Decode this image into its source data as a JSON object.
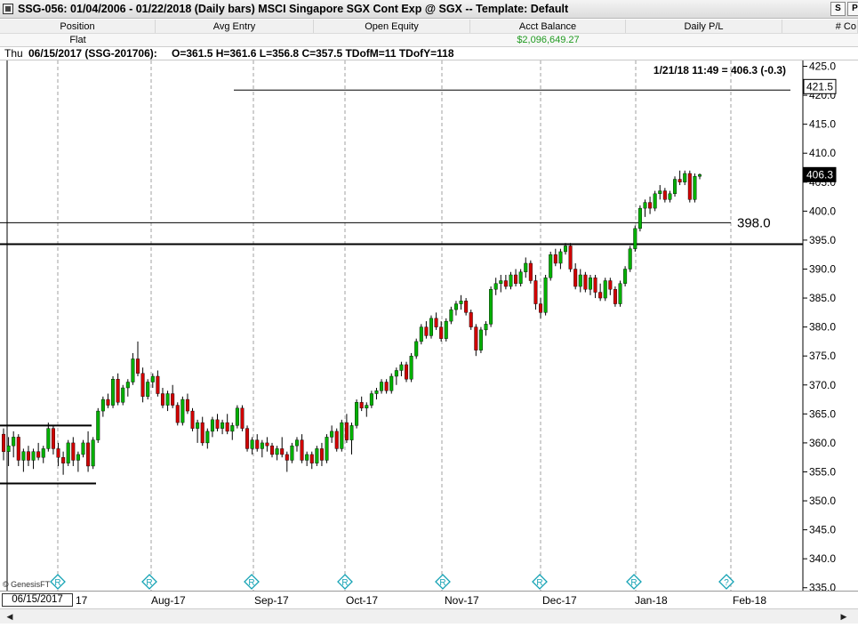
{
  "window": {
    "title": "SSG-056:  01/04/2006 - 01/22/2018  (Daily bars)   MSCI Singapore SGX Cont Exp @ SGX  --  Template: Default",
    "btn_s": "S",
    "btn_p": "P"
  },
  "account": {
    "headers": [
      "Position",
      "Avg Entry",
      "Open Equity",
      "Acct Balance",
      "Daily P/L",
      "# Co"
    ],
    "position_value": "Flat",
    "balance_value": "$2,096,649.27"
  },
  "info": {
    "day": "Thu",
    "date_symbol": "06/15/2017 (SSG-201706):",
    "ohlc": "O=361.5  H=361.6  L=356.8  C=357.5  TDofM=11  TDofY=118"
  },
  "chart_data": {
    "type": "candlestick",
    "title": "",
    "last_quote": "1/21/18 11:49 = 406.3 (-0.3)",
    "y_ticks": [
      335.0,
      340.0,
      345.0,
      350.0,
      355.0,
      360.0,
      365.0,
      370.0,
      375.0,
      380.0,
      385.0,
      390.0,
      395.0,
      400.0,
      405.0,
      410.0,
      415.0,
      420.0,
      425.0
    ],
    "ylim": [
      334.5,
      426.0
    ],
    "price_flag": "406.3",
    "price_flag_value": 406.3,
    "alert_flag": "421.5",
    "alert_flag_value": 421.5,
    "hline_label": "398.0",
    "hline_value": 398.0,
    "support_line_value": 394.3,
    "upper_line_value": 420.9,
    "x_labels": [
      "17",
      "Aug-17",
      "Sep-17",
      "Oct-17",
      "Nov-17",
      "Dec-17",
      "Jan-18",
      "Feb-18"
    ],
    "watermark": "© GenesisFT",
    "bars": [
      [
        361.5,
        362.5,
        357.0,
        358.5
      ],
      [
        358.5,
        361.0,
        356.0,
        359.5
      ],
      [
        359.5,
        362.0,
        357.5,
        361.0
      ],
      [
        361.0,
        361.5,
        356.0,
        357.0
      ],
      [
        357.0,
        359.0,
        355.0,
        358.5
      ],
      [
        358.5,
        359.5,
        356.0,
        357.0
      ],
      [
        357.0,
        359.0,
        355.5,
        358.5
      ],
      [
        358.5,
        360.0,
        357.0,
        357.5
      ],
      [
        357.5,
        359.5,
        356.5,
        359.0
      ],
      [
        359.0,
        363.5,
        358.5,
        362.5
      ],
      [
        362.5,
        363.0,
        358.0,
        359.0
      ],
      [
        359.0,
        360.0,
        356.0,
        357.5
      ],
      [
        357.5,
        358.5,
        354.5,
        356.5
      ],
      [
        356.5,
        360.5,
        356.0,
        360.0
      ],
      [
        360.0,
        361.0,
        356.0,
        357.0
      ],
      [
        357.0,
        358.5,
        355.0,
        358.0
      ],
      [
        358.0,
        360.5,
        357.5,
        360.0
      ],
      [
        360.0,
        362.0,
        355.0,
        356.0
      ],
      [
        356.0,
        361.0,
        355.5,
        360.5
      ],
      [
        360.5,
        366.0,
        360.0,
        365.5
      ],
      [
        365.5,
        368.0,
        364.5,
        367.5
      ],
      [
        367.5,
        368.5,
        366.0,
        366.5
      ],
      [
        366.5,
        371.5,
        366.0,
        371.0
      ],
      [
        371.0,
        372.0,
        366.5,
        367.0
      ],
      [
        367.0,
        370.0,
        366.5,
        369.5
      ],
      [
        369.5,
        371.0,
        368.0,
        370.5
      ],
      [
        370.5,
        375.5,
        370.0,
        374.5
      ],
      [
        374.5,
        377.5,
        371.5,
        372.0
      ],
      [
        372.0,
        373.0,
        367.0,
        368.0
      ],
      [
        368.0,
        371.0,
        367.5,
        370.5
      ],
      [
        370.5,
        372.0,
        369.5,
        371.5
      ],
      [
        371.5,
        372.5,
        368.0,
        368.5
      ],
      [
        368.5,
        369.5,
        366.0,
        366.5
      ],
      [
        366.5,
        369.0,
        365.5,
        368.5
      ],
      [
        368.5,
        370.0,
        366.0,
        366.5
      ],
      [
        366.5,
        367.0,
        363.0,
        363.5
      ],
      [
        363.5,
        368.0,
        363.0,
        367.5
      ],
      [
        367.5,
        368.5,
        365.0,
        365.5
      ],
      [
        365.5,
        366.0,
        362.0,
        362.5
      ],
      [
        362.5,
        364.0,
        360.0,
        363.5
      ],
      [
        363.5,
        364.5,
        359.5,
        360.0
      ],
      [
        360.0,
        362.5,
        359.0,
        362.0
      ],
      [
        362.0,
        364.5,
        361.0,
        364.0
      ],
      [
        364.0,
        365.0,
        362.0,
        362.5
      ],
      [
        362.5,
        364.0,
        361.5,
        363.5
      ],
      [
        363.5,
        365.0,
        361.5,
        362.0
      ],
      [
        362.0,
        363.5,
        360.5,
        363.0
      ],
      [
        363.0,
        366.5,
        362.5,
        366.0
      ],
      [
        366.0,
        366.5,
        362.0,
        362.5
      ],
      [
        362.5,
        363.0,
        358.5,
        359.0
      ],
      [
        359.0,
        361.0,
        358.0,
        360.5
      ],
      [
        360.5,
        361.5,
        358.5,
        359.0
      ],
      [
        359.0,
        360.5,
        357.5,
        360.0
      ],
      [
        360.0,
        361.0,
        358.5,
        359.5
      ],
      [
        359.5,
        360.0,
        357.5,
        358.0
      ],
      [
        358.0,
        359.5,
        357.0,
        359.0
      ],
      [
        359.0,
        361.0,
        357.5,
        358.0
      ],
      [
        358.0,
        358.5,
        355.0,
        357.0
      ],
      [
        357.0,
        360.0,
        356.5,
        359.5
      ],
      [
        359.5,
        361.0,
        358.5,
        360.5
      ],
      [
        360.5,
        361.5,
        356.5,
        357.0
      ],
      [
        357.0,
        358.5,
        356.0,
        358.0
      ],
      [
        358.0,
        358.5,
        355.5,
        356.5
      ],
      [
        356.5,
        359.5,
        356.0,
        359.0
      ],
      [
        359.0,
        360.0,
        356.0,
        357.0
      ],
      [
        357.0,
        361.5,
        356.5,
        361.0
      ],
      [
        361.0,
        363.0,
        360.0,
        362.0
      ],
      [
        362.0,
        362.5,
        358.5,
        359.0
      ],
      [
        359.0,
        364.0,
        358.5,
        363.5
      ],
      [
        363.5,
        365.0,
        360.0,
        360.5
      ],
      [
        360.5,
        363.5,
        358.0,
        363.0
      ],
      [
        363.0,
        367.5,
        362.5,
        367.0
      ],
      [
        367.0,
        368.0,
        365.5,
        366.0
      ],
      [
        366.0,
        367.0,
        364.5,
        366.5
      ],
      [
        366.5,
        369.0,
        366.0,
        368.5
      ],
      [
        368.5,
        369.5,
        367.5,
        369.0
      ],
      [
        369.0,
        371.0,
        368.5,
        370.5
      ],
      [
        370.5,
        371.0,
        368.5,
        369.0
      ],
      [
        369.0,
        372.0,
        368.5,
        371.5
      ],
      [
        371.5,
        373.0,
        370.0,
        372.5
      ],
      [
        372.5,
        374.0,
        371.5,
        373.5
      ],
      [
        373.5,
        374.0,
        370.5,
        371.0
      ],
      [
        371.0,
        375.5,
        370.5,
        375.0
      ],
      [
        375.0,
        378.0,
        374.5,
        377.5
      ],
      [
        377.5,
        380.5,
        377.0,
        380.0
      ],
      [
        380.0,
        381.0,
        378.0,
        378.5
      ],
      [
        378.5,
        382.0,
        378.0,
        381.5
      ],
      [
        381.5,
        382.5,
        379.5,
        380.0
      ],
      [
        380.0,
        381.0,
        377.5,
        378.0
      ],
      [
        378.0,
        381.5,
        377.5,
        381.0
      ],
      [
        381.0,
        383.5,
        380.5,
        383.0
      ],
      [
        383.0,
        384.5,
        382.0,
        384.0
      ],
      [
        384.0,
        385.5,
        383.0,
        384.5
      ],
      [
        384.5,
        385.0,
        382.0,
        382.5
      ],
      [
        382.5,
        383.0,
        379.5,
        380.0
      ],
      [
        380.0,
        380.5,
        375.0,
        376.0
      ],
      [
        376.0,
        380.0,
        375.5,
        379.5
      ],
      [
        379.5,
        381.0,
        378.5,
        380.5
      ],
      [
        380.5,
        387.0,
        380.0,
        386.5
      ],
      [
        386.5,
        388.5,
        385.5,
        387.5
      ],
      [
        387.5,
        389.0,
        386.0,
        388.0
      ],
      [
        388.0,
        389.0,
        386.5,
        387.0
      ],
      [
        387.0,
        389.5,
        386.5,
        389.0
      ],
      [
        389.0,
        390.0,
        387.0,
        387.5
      ],
      [
        387.5,
        390.0,
        387.0,
        389.5
      ],
      [
        389.5,
        392.0,
        388.5,
        391.0
      ],
      [
        391.0,
        391.5,
        387.5,
        388.0
      ],
      [
        388.0,
        389.0,
        383.0,
        384.0
      ],
      [
        384.0,
        385.0,
        381.5,
        382.5
      ],
      [
        382.5,
        389.0,
        382.0,
        388.5
      ],
      [
        388.5,
        393.0,
        388.0,
        392.5
      ],
      [
        392.5,
        393.5,
        390.5,
        391.0
      ],
      [
        391.0,
        393.5,
        390.0,
        393.0
      ],
      [
        393.0,
        394.5,
        392.5,
        394.0
      ],
      [
        394.0,
        394.5,
        389.5,
        390.0
      ],
      [
        390.0,
        391.0,
        386.5,
        387.0
      ],
      [
        387.0,
        390.0,
        386.0,
        389.0
      ],
      [
        389.0,
        389.5,
        386.0,
        386.5
      ],
      [
        386.5,
        389.0,
        385.5,
        388.5
      ],
      [
        388.5,
        389.0,
        385.0,
        386.0
      ],
      [
        386.0,
        387.5,
        384.5,
        385.0
      ],
      [
        385.0,
        388.5,
        384.5,
        388.0
      ],
      [
        388.0,
        388.5,
        385.5,
        386.5
      ],
      [
        386.5,
        387.0,
        383.5,
        384.0
      ],
      [
        384.0,
        388.0,
        383.5,
        387.5
      ],
      [
        387.5,
        390.5,
        387.0,
        390.0
      ],
      [
        390.0,
        394.0,
        389.5,
        393.5
      ],
      [
        393.5,
        397.5,
        393.0,
        397.0
      ],
      [
        397.0,
        401.0,
        396.5,
        400.5
      ],
      [
        400.5,
        402.0,
        399.0,
        401.5
      ],
      [
        401.5,
        402.5,
        399.5,
        400.5
      ],
      [
        400.5,
        403.5,
        400.0,
        403.0
      ],
      [
        403.0,
        404.5,
        402.0,
        403.5
      ],
      [
        403.5,
        404.0,
        401.5,
        402.0
      ],
      [
        402.0,
        403.5,
        401.5,
        403.0
      ],
      [
        403.0,
        406.0,
        402.5,
        405.5
      ],
      [
        405.5,
        407.0,
        404.5,
        405.0
      ],
      [
        405.0,
        407.0,
        404.5,
        406.5
      ],
      [
        406.5,
        407.0,
        401.5,
        402.0
      ],
      [
        402.0,
        406.5,
        401.5,
        406.0
      ],
      [
        406.0,
        406.5,
        405.5,
        406.3
      ]
    ],
    "colors": {
      "up": "#00b000",
      "down": "#d00000",
      "wick": "#000000",
      "grid": "#a0a0a0",
      "diamond": "#16a3b5"
    }
  }
}
